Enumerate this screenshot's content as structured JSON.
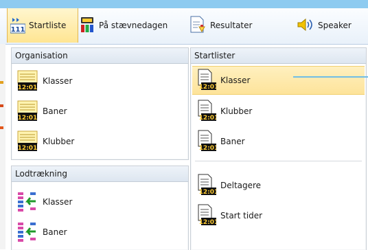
{
  "toolbar": {
    "tabs": [
      {
        "label": "Startliste",
        "icon": "startlist-tab-icon",
        "active": true
      },
      {
        "label": "På stævnedagen",
        "icon": "race-day-icon",
        "active": false
      },
      {
        "label": "Resultater",
        "icon": "results-icon",
        "active": false
      },
      {
        "label": "Speaker",
        "icon": "speaker-icon",
        "active": false
      }
    ]
  },
  "panels": {
    "organisation": {
      "title": "Organisation",
      "items": [
        {
          "label": "Klasser",
          "icon": "class-list-icon"
        },
        {
          "label": "Baner",
          "icon": "course-list-icon"
        },
        {
          "label": "Klubber",
          "icon": "club-list-icon"
        }
      ]
    },
    "lodtraekning": {
      "title": "Lodtrækning",
      "items": [
        {
          "label": "Klasser",
          "icon": "draw-classes-icon"
        },
        {
          "label": "Baner",
          "icon": "draw-courses-icon"
        }
      ]
    },
    "startlister": {
      "title": "Startlister",
      "items": [
        {
          "label": "Klasser",
          "icon": "startlist-classes-icon",
          "selected": true
        },
        {
          "label": "Klubber",
          "icon": "startlist-clubs-icon"
        },
        {
          "label": "Baner",
          "icon": "startlist-courses-icon"
        },
        {
          "label": "Deltagere",
          "icon": "startlist-participants-icon"
        },
        {
          "label": "Start tider",
          "icon": "start-times-icon"
        }
      ]
    }
  },
  "icons": {
    "clock_text": "12:01",
    "tab_icon_text": "111"
  },
  "colors": {
    "top_strip": "#8ecbf0",
    "active_tab": "#ffe592",
    "selected_row": "#fde39a",
    "callout_line": "#6fbde6"
  }
}
